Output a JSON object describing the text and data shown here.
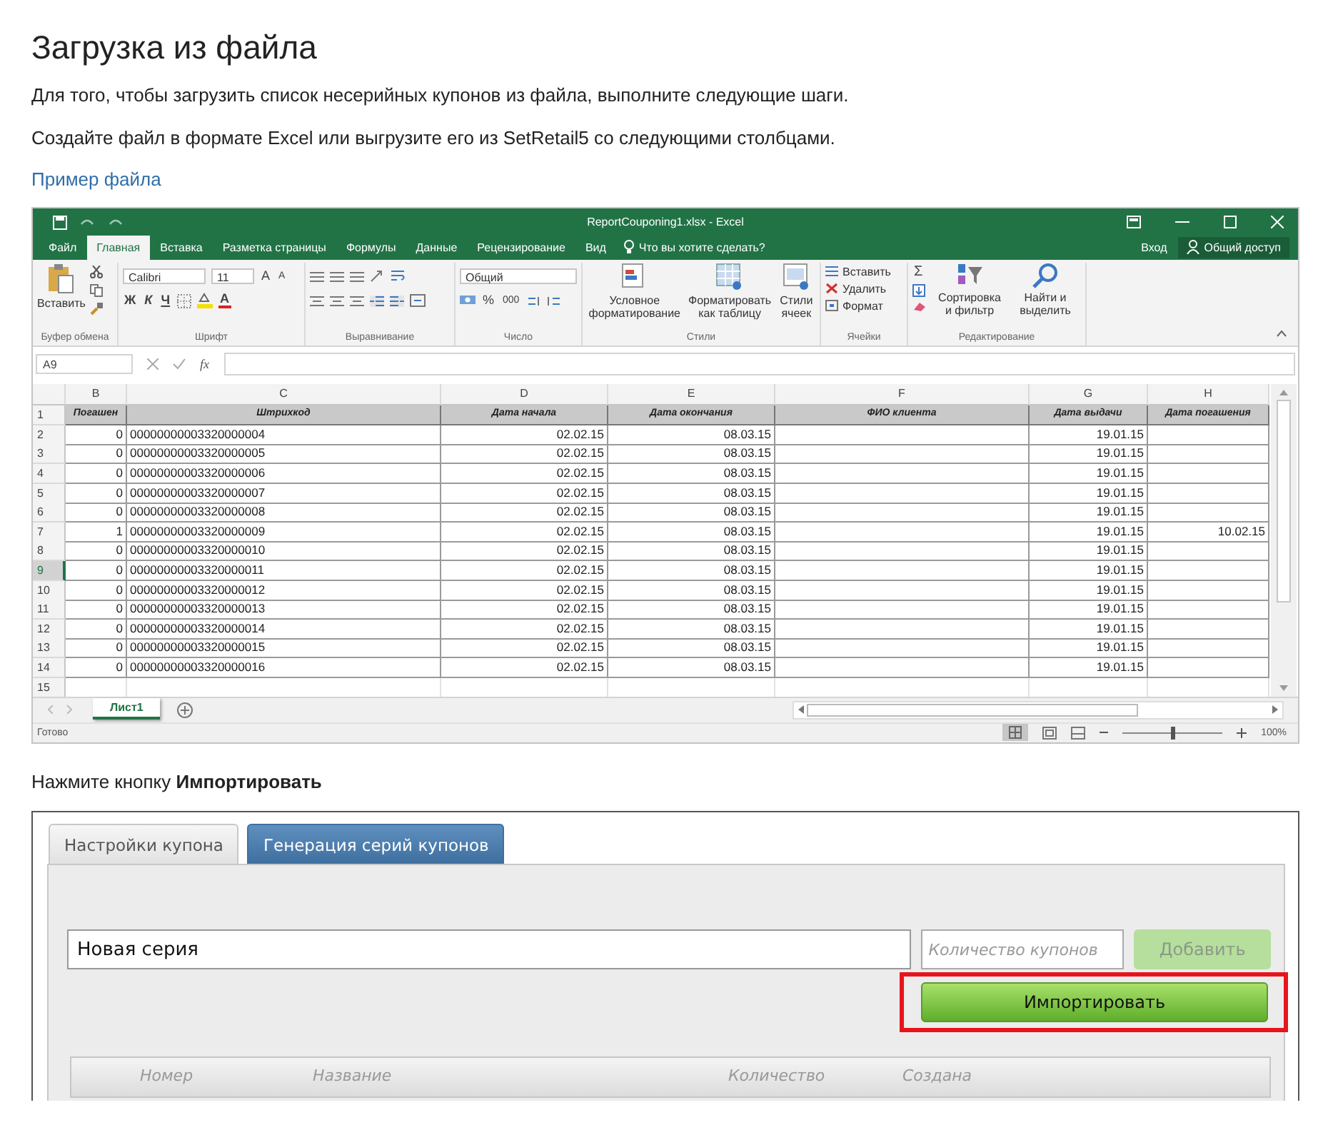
{
  "title": "Загрузка из файла",
  "intro": "Для того, чтобы загрузить список несерийных купонов из файла, выполните следующие шаги.",
  "step1": "Создайте файл в формате Excel или выгрузите его из SetRetail5 со следующими столбцами.",
  "sample_link": "Пример файла",
  "excel": {
    "window_title": "ReportCouponing1.xlsx - Excel",
    "tabs": [
      {
        "label": "Файл",
        "selected": false
      },
      {
        "label": "Главная",
        "selected": true
      },
      {
        "label": "Вставка",
        "selected": false
      },
      {
        "label": "Разметка страницы",
        "selected": false
      },
      {
        "label": "Формулы",
        "selected": false
      },
      {
        "label": "Данные",
        "selected": false
      },
      {
        "label": "Рецензирование",
        "selected": false
      },
      {
        "label": "Вид",
        "selected": false
      }
    ],
    "tell_me": "Что вы хотите сделать?",
    "sign_in": "Вход",
    "share": "Общий доступ",
    "ribbon": {
      "paste": "Вставить",
      "font": "Calibri",
      "size": "11",
      "grow": "A",
      "shrink": "A",
      "bold": "Ж",
      "italic": "К",
      "underline": "Ч",
      "font_color": "A",
      "number_format": "Общий",
      "percent": "%",
      "thousands": "000",
      "conditional": "Условное форматирование",
      "as_table": "Форматировать как таблицу",
      "cell_styles": "Стили ячеек",
      "insert": "Вставить",
      "delete": "Удалить",
      "format": "Формат",
      "sum": "Σ",
      "sort": "Сортировка и фильтр",
      "find": "Найти и выделить",
      "groups": [
        "Буфер обмена",
        "Шрифт",
        "Выравнивание",
        "Число",
        "Стили",
        "Ячейки",
        "Редактирование"
      ]
    },
    "name_box": "A9",
    "function_label": "fx",
    "columns": [
      "B",
      "C",
      "D",
      "E",
      "F",
      "G",
      "H"
    ],
    "rows": [
      {
        "row": "1",
        "kind": "header",
        "selected": false,
        "cells": {
          "B": "Погашен",
          "C": "Штрихкод",
          "D": "Дата начала",
          "E": "Дата окончания",
          "F": "ФИО клиента",
          "G": "Дата выдачи",
          "H": "Дата погашения"
        }
      },
      {
        "row": "2",
        "kind": "data",
        "selected": false,
        "cells": {
          "B": "0",
          "C": "00000000003320000004",
          "D": "02.02.15",
          "E": "08.03.15",
          "G": "19.01.15"
        }
      },
      {
        "row": "3",
        "kind": "data",
        "selected": false,
        "cells": {
          "B": "0",
          "C": "00000000003320000005",
          "D": "02.02.15",
          "E": "08.03.15",
          "G": "19.01.15"
        }
      },
      {
        "row": "4",
        "kind": "data",
        "selected": false,
        "cells": {
          "B": "0",
          "C": "00000000003320000006",
          "D": "02.02.15",
          "E": "08.03.15",
          "G": "19.01.15"
        }
      },
      {
        "row": "5",
        "kind": "data",
        "selected": false,
        "cells": {
          "B": "0",
          "C": "00000000003320000007",
          "D": "02.02.15",
          "E": "08.03.15",
          "G": "19.01.15"
        }
      },
      {
        "row": "6",
        "kind": "data",
        "selected": false,
        "cells": {
          "B": "0",
          "C": "00000000003320000008",
          "D": "02.02.15",
          "E": "08.03.15",
          "G": "19.01.15"
        }
      },
      {
        "row": "7",
        "kind": "data",
        "selected": false,
        "cells": {
          "B": "1",
          "C": "00000000003320000009",
          "D": "02.02.15",
          "E": "08.03.15",
          "G": "19.01.15",
          "H": "10.02.15"
        }
      },
      {
        "row": "8",
        "kind": "data",
        "selected": false,
        "cells": {
          "B": "0",
          "C": "00000000003320000010",
          "D": "02.02.15",
          "E": "08.03.15",
          "G": "19.01.15"
        }
      },
      {
        "row": "9",
        "kind": "data",
        "selected": true,
        "cells": {
          "B": "0",
          "C": "00000000003320000011",
          "D": "02.02.15",
          "E": "08.03.15",
          "G": "19.01.15"
        }
      },
      {
        "row": "10",
        "kind": "data",
        "selected": false,
        "cells": {
          "B": "0",
          "C": "00000000003320000012",
          "D": "02.02.15",
          "E": "08.03.15",
          "G": "19.01.15"
        }
      },
      {
        "row": "11",
        "kind": "data",
        "selected": false,
        "cells": {
          "B": "0",
          "C": "00000000003320000013",
          "D": "02.02.15",
          "E": "08.03.15",
          "G": "19.01.15"
        }
      },
      {
        "row": "12",
        "kind": "data",
        "selected": false,
        "cells": {
          "B": "0",
          "C": "00000000003320000014",
          "D": "02.02.15",
          "E": "08.03.15",
          "G": "19.01.15"
        }
      },
      {
        "row": "13",
        "kind": "data",
        "selected": false,
        "cells": {
          "B": "0",
          "C": "00000000003320000015",
          "D": "02.02.15",
          "E": "08.03.15",
          "G": "19.01.15"
        }
      },
      {
        "row": "14",
        "kind": "data",
        "selected": false,
        "cells": {
          "B": "0",
          "C": "00000000003320000016",
          "D": "02.02.15",
          "E": "08.03.15",
          "G": "19.01.15"
        }
      },
      {
        "row": "15",
        "kind": "empty",
        "selected": false,
        "cells": {}
      }
    ],
    "sheet_tabs": [
      {
        "label": "Лист1",
        "selected": true
      }
    ],
    "status": "Готово",
    "zoom": {
      "level": 0.5,
      "reading": "100%"
    }
  },
  "step2": "Нажмите кнопку **Импортировать**",
  "app": {
    "tabs": [
      {
        "label": "Настройки купона",
        "selected": false
      },
      {
        "label": "Генерация серий купонов",
        "selected": true
      }
    ],
    "series_name": "Новая серия",
    "count_placeholder": "Количество купонов",
    "add_button": {
      "label": "Добавить",
      "disabled": true
    },
    "import_button": {
      "label": "Импортировать",
      "highlighted": true
    },
    "table_columns": [
      "Номер",
      "Название",
      "Количество",
      "Создана"
    ]
  }
}
